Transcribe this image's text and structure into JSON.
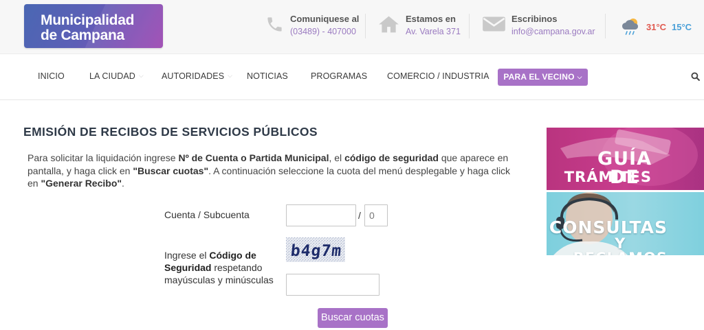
{
  "header": {
    "logo": {
      "line1": "Municipalidad",
      "line2": "de Campana"
    },
    "contacts": [
      {
        "title": "Comuniquese al",
        "value": "(03489) - 407000",
        "icon": "phone-icon"
      },
      {
        "title": "Estamos en",
        "value": "Av. Varela 371",
        "icon": "home-icon"
      },
      {
        "title": "Escribinos",
        "value": "info@campana.gov.ar",
        "icon": "mail-icon"
      }
    ],
    "weather": {
      "icon": "cloud-rain-sun-icon",
      "max": "31°C",
      "min": "15°C"
    }
  },
  "nav": {
    "items": [
      {
        "label": "INICIO"
      },
      {
        "label": "LA CIUDAD"
      },
      {
        "label": "AUTORIDADES"
      },
      {
        "label": "NOTICIAS"
      },
      {
        "label": "PROGRAMAS"
      },
      {
        "label": "COMERCIO / INDUSTRIA"
      }
    ],
    "highlight": {
      "label": "PARA EL VECINO"
    },
    "search_icon": "search-icon"
  },
  "main": {
    "title": "EMISIÓN DE RECIBOS DE SERVICIOS PÚBLICOS",
    "intro": {
      "t1": "Para solicitar la liquidación ingrese ",
      "b1": "Nº de Cuenta o Partida Municipal",
      "t2": ", el ",
      "b2": "código de seguridad",
      "t3": " que aparece en pantalla, y haga click en ",
      "b3": "\"Buscar cuotas\"",
      "t4": ". A continuación seleccione la cuota del menú desplegable y haga click en ",
      "b4": "\"Generar Recibo\"",
      "t5": "."
    },
    "form": {
      "cuenta_label": "Cuenta / Subcuenta",
      "cuenta_value": "",
      "separator": "/",
      "subcuenta_value": "0",
      "codigo_label_1": "Ingrese el ",
      "codigo_label_bold": "Código de Seguridad",
      "codigo_label_2": " respetando mayúsculas y minúsculas",
      "captcha_text": "b4g7m",
      "codigo_value": "",
      "submit_label": "Buscar cuotas"
    }
  },
  "sidebar": {
    "banners": [
      {
        "line1": "GUÍA DE",
        "line2": "TRÁMITES",
        "color": "#c03a87"
      },
      {
        "line1": "CONSULTAS",
        "line2": "Y RECLAMOS",
        "color": "#8ad3df"
      }
    ]
  },
  "colors": {
    "accent": "#a872c7",
    "link": "#9a7ac0",
    "temp_max": "#e05a50",
    "temp_min": "#4aa0d8"
  }
}
